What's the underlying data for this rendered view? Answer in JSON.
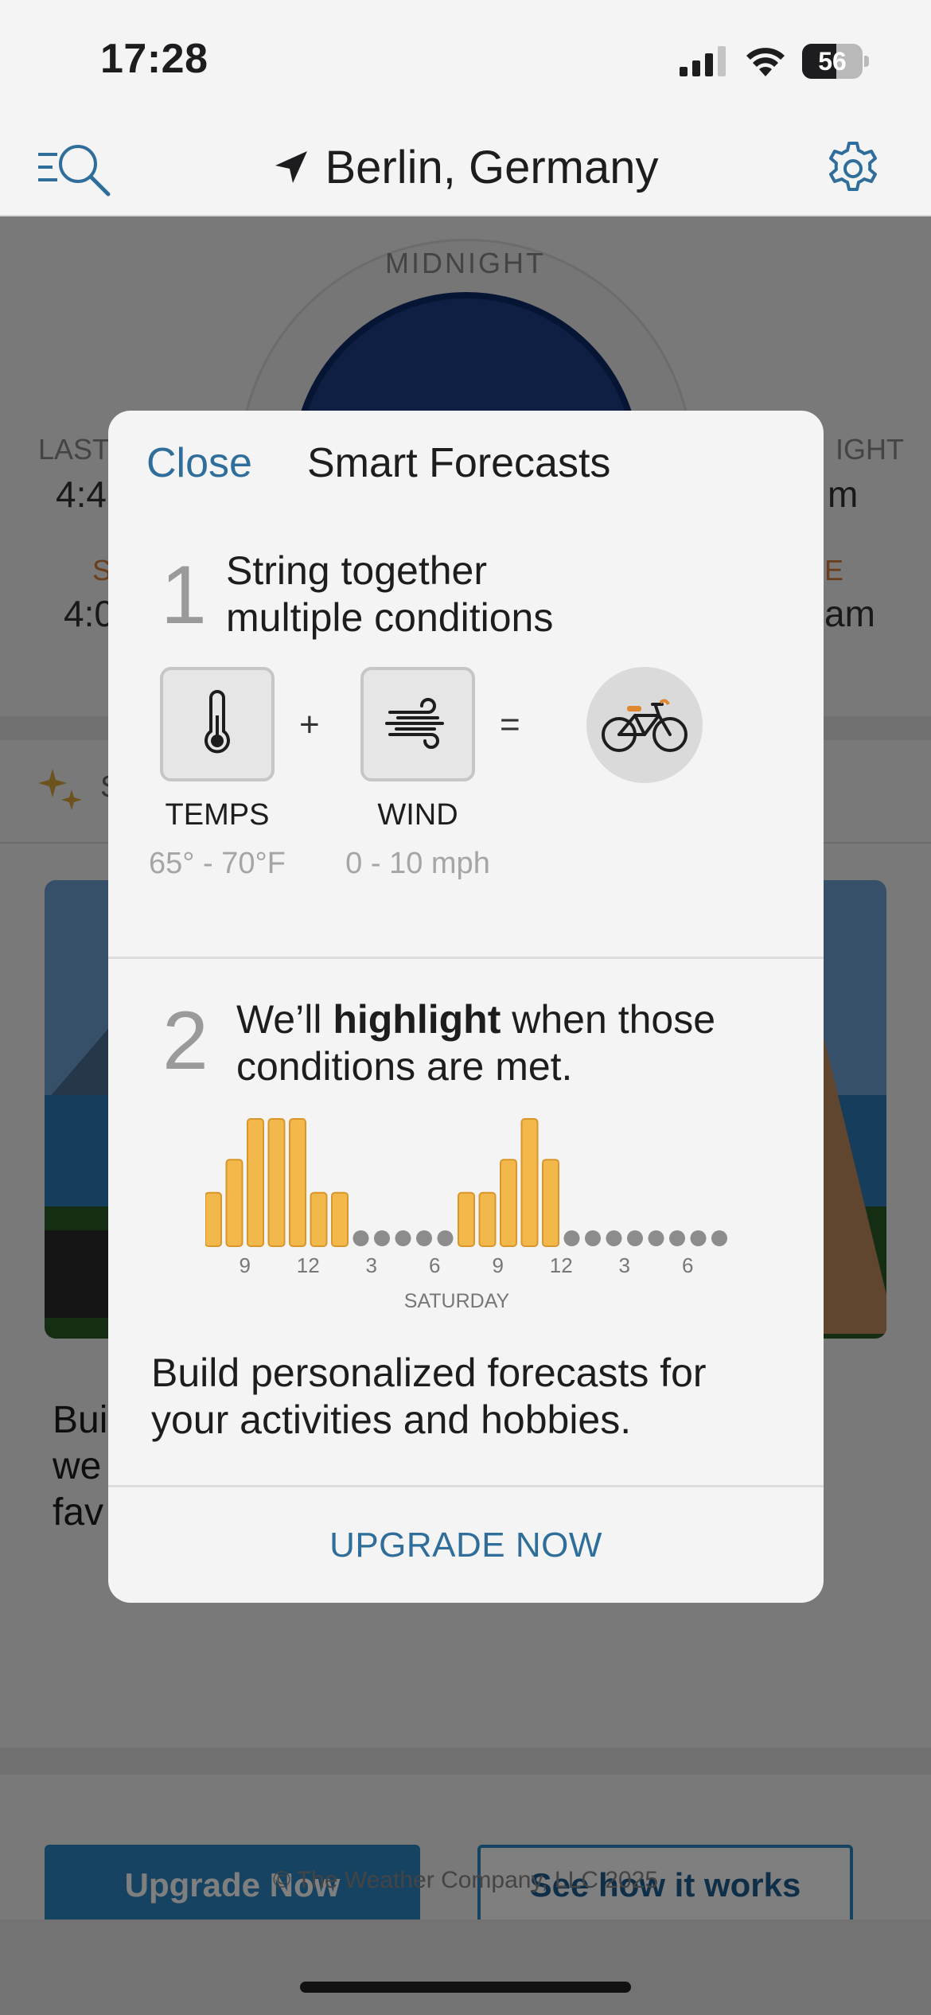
{
  "status_bar": {
    "time": "17:28",
    "battery": "56",
    "battery_fraction": 0.56,
    "icons": [
      "signal-icon",
      "wifi-icon",
      "battery-icon"
    ]
  },
  "header": {
    "location": "Berlin, Germany",
    "icons": [
      "menu-search-icon",
      "location-arrow-icon",
      "gear-icon"
    ]
  },
  "background": {
    "dial_label": "MIDNIGHT",
    "stat_left_label": "LAST",
    "stat_left_value": "4:4",
    "stat_left_label2": "S",
    "stat_left_value2": "4:0",
    "stat_right_label": "IGHT",
    "stat_right_value": "m",
    "stat_right_label2": "E",
    "stat_right_value2": "am",
    "section_initial": "S",
    "promo_text_lines": [
      "Bui",
      "we",
      "fav"
    ],
    "primary_button": "Upgrade Now",
    "secondary_button": "See how it works",
    "copyright": "© The Weather Company, LLC 2025"
  },
  "modal": {
    "close": "Close",
    "title": "Smart Forecasts",
    "step1": {
      "number": "1",
      "text_line1": "String together",
      "text_line2": "multiple conditions",
      "conditions": [
        {
          "label": "TEMPS",
          "range": "65° - 70°F",
          "icon": "thermometer-icon"
        },
        {
          "label": "WIND",
          "range": "0 - 10 mph",
          "icon": "wind-icon"
        }
      ],
      "plus": "+",
      "equals": "=",
      "result_icon": "bicycle-icon"
    },
    "step2": {
      "number": "2",
      "text_pre": "We’ll ",
      "text_bold": "highlight",
      "text_post": " when those",
      "text_line2": "conditions are met."
    },
    "chart_data": {
      "type": "bar",
      "x_ticks": [
        "9",
        "12",
        "3",
        "6",
        "9",
        "12",
        "3",
        "6"
      ],
      "xlabel": "SATURDAY",
      "values": [
        0.42,
        0.68,
        1.0,
        1.0,
        1.0,
        0.42,
        0.42,
        0,
        0,
        0,
        0,
        0,
        0.42,
        0.42,
        0.68,
        1.0,
        0.68,
        0,
        0,
        0,
        0,
        0,
        0,
        0,
        0
      ],
      "ylim": [
        0,
        1
      ],
      "highlight_color": "#f2b84b",
      "inactive_color": "#8c8c8c"
    },
    "description_line1": "Build personalized forecasts for",
    "description_line2": "your activities and hobbies.",
    "upgrade": "UPGRADE NOW"
  }
}
